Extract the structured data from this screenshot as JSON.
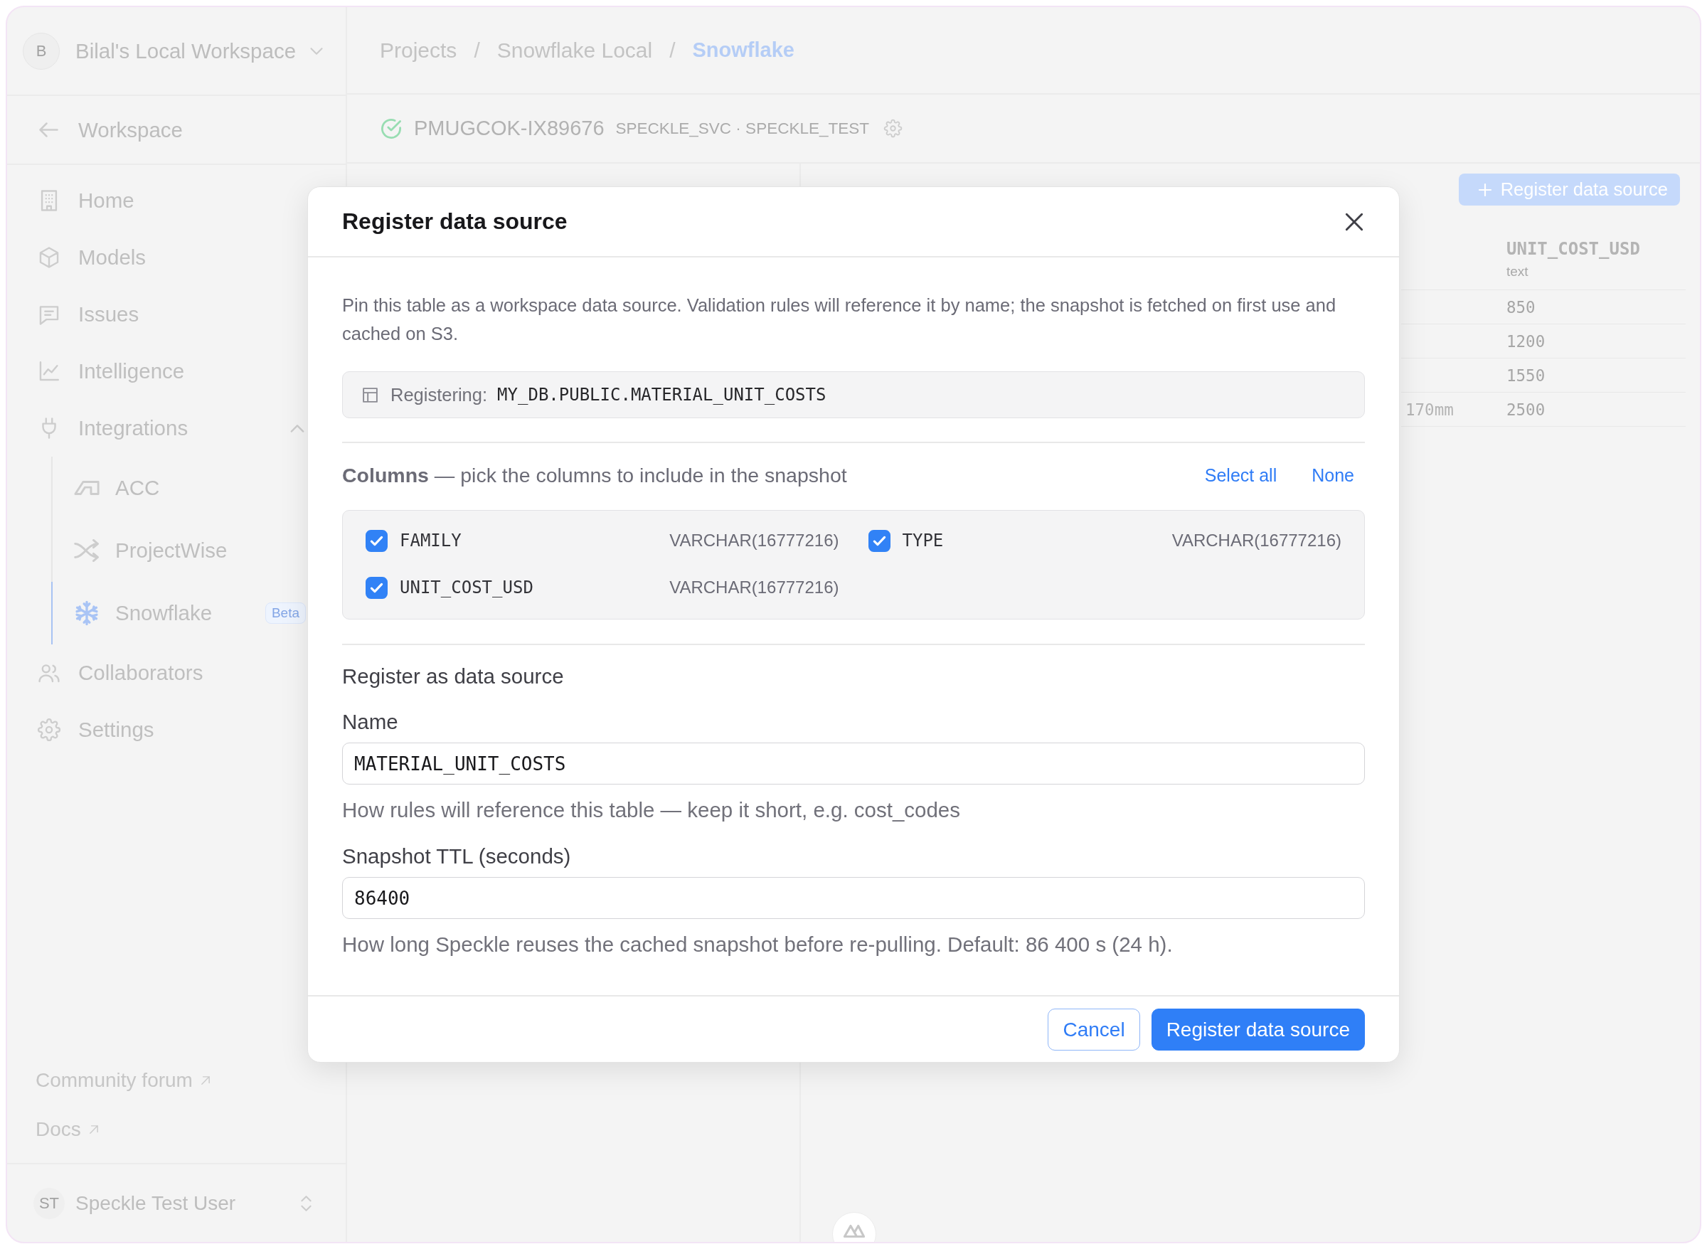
{
  "sidebar": {
    "workspace": {
      "avatar": "B",
      "name": "Bilal's Local Workspace"
    },
    "back_link": "Workspace",
    "nav": [
      {
        "label": "Home",
        "selected": false
      },
      {
        "label": "Models",
        "selected": false
      },
      {
        "label": "Issues",
        "selected": false
      },
      {
        "label": "Intelligence",
        "selected": false
      },
      {
        "label": "Integrations",
        "selected": false,
        "expanded": true,
        "children": [
          {
            "label": "ACC",
            "selected": false
          },
          {
            "label": "ProjectWise",
            "selected": false
          },
          {
            "label": "Snowflake",
            "selected": true,
            "badge": "Beta"
          }
        ]
      },
      {
        "label": "Collaborators",
        "selected": false
      },
      {
        "label": "Settings",
        "selected": false
      }
    ],
    "footer_links": [
      "Community forum",
      "Docs"
    ],
    "user": {
      "initials": "ST",
      "name": "Speckle Test User"
    }
  },
  "breadcrumb": [
    {
      "label": "Projects",
      "current": false,
      "separator": "/"
    },
    {
      "label": "Snowflake Local",
      "current": false,
      "separator": "/"
    },
    {
      "label": "Snowflake",
      "current": true
    }
  ],
  "connection": {
    "connected": true,
    "account": "PMUGCOK-IX89676",
    "details": "SPECKLE_SVC · SPECKLE_TEST"
  },
  "register_button": "Register data source",
  "table": {
    "columns": [
      {
        "name": "UNIT_COST_USD",
        "type": "text"
      }
    ],
    "rows": [
      {
        "unit_cost_usd": "850"
      },
      {
        "unit_cost_usd": "1200"
      },
      {
        "unit_cost_usd": "1550"
      },
      {
        "column_1": "170mm",
        "unit_cost_usd": "2500"
      }
    ]
  },
  "dialog": {
    "title": "Register data source",
    "description": "Pin this table as a workspace data source. Validation rules will reference it by name; the snapshot is fetched on first use and cached on S3.",
    "registering": {
      "label": "Registering:",
      "value": "MY_DB.PUBLIC.MATERIAL_UNIT_COSTS"
    },
    "columns_heading": "**Columns** — pick the columns to include in the snapshot",
    "select_all": "Select all",
    "select_none": "None",
    "columns": [
      {
        "name": "FAMILY",
        "type": "VARCHAR(16777216)",
        "checked": true
      },
      {
        "name": "TYPE",
        "type": "VARCHAR(16777216)",
        "checked": true
      },
      {
        "name": "UNIT_COST_USD",
        "type": "VARCHAR(16777216)",
        "checked": true
      }
    ],
    "section_title": "Register as data source",
    "fields": [
      {
        "label": "Name",
        "value": "MATERIAL_UNIT_COSTS",
        "hint": "How rules will reference this table — keep it short, e.g. cost_codes"
      },
      {
        "label": "Snapshot TTL (seconds)",
        "value": "86400",
        "hint": "How long Speckle reuses the cached snapshot before re-pulling. Default: 86 400 s (24 h)."
      }
    ],
    "buttons": [
      {
        "label": "Cancel",
        "kind": "secondary"
      },
      {
        "label": "Register data source",
        "kind": "primary"
      }
    ]
  }
}
